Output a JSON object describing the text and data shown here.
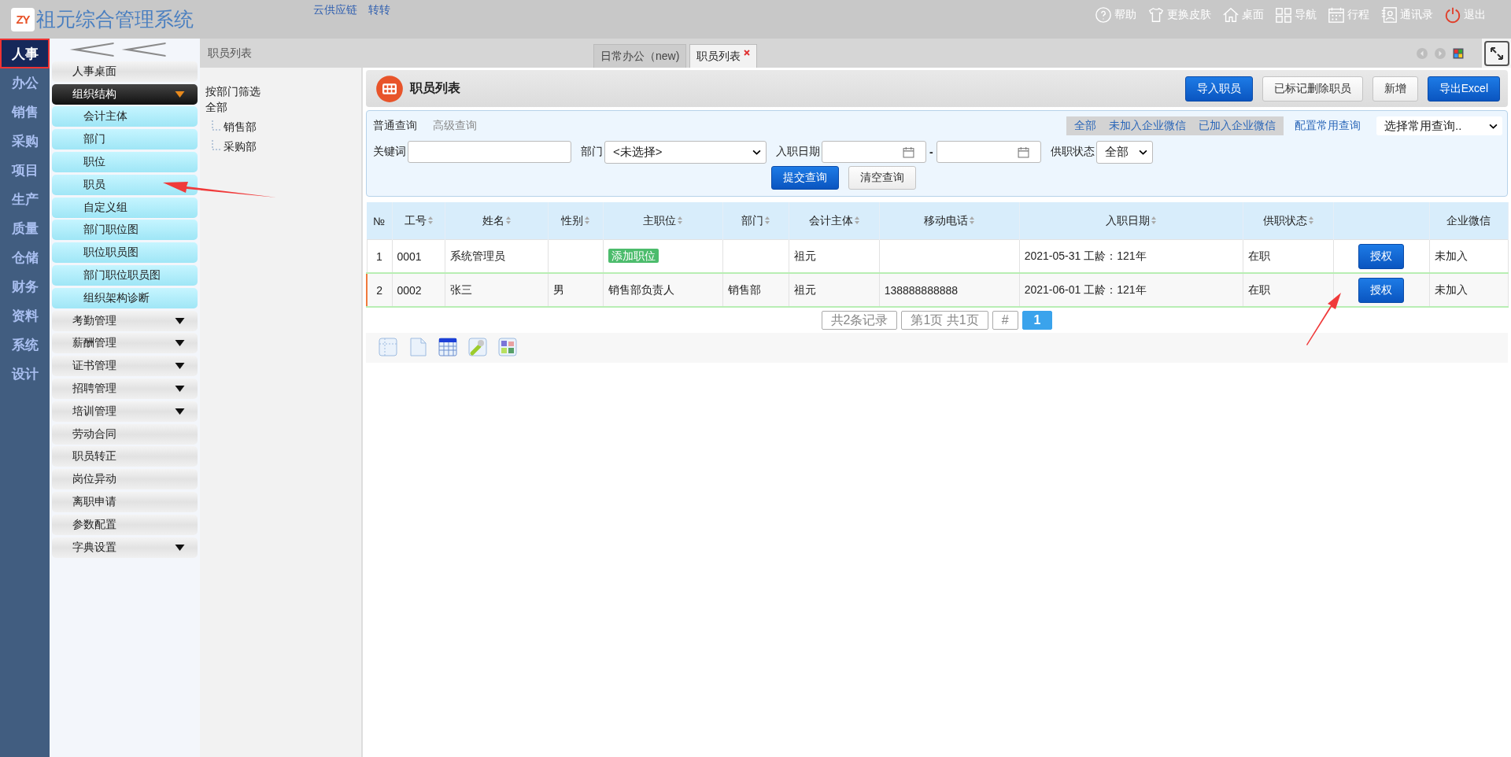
{
  "header": {
    "logo_mark": "ZY",
    "title": "祖元综合管理系统",
    "top_links": [
      "云供应链",
      "转转"
    ],
    "toolbar": [
      {
        "label": "帮助"
      },
      {
        "label": "更换皮肤"
      },
      {
        "label": "桌面"
      },
      {
        "label": "导航"
      },
      {
        "label": "行程"
      },
      {
        "label": "通讯录"
      },
      {
        "label": "退出"
      }
    ]
  },
  "module_nav": [
    {
      "label": "人事",
      "selected": true
    },
    {
      "label": "办公",
      "selected": false
    },
    {
      "label": "销售",
      "selected": false
    },
    {
      "label": "采购",
      "selected": false
    },
    {
      "label": "项目",
      "selected": false
    },
    {
      "label": "生产",
      "selected": false
    },
    {
      "label": "质量",
      "selected": false
    },
    {
      "label": "仓储",
      "selected": false
    },
    {
      "label": "财务",
      "selected": false
    },
    {
      "label": "资料",
      "selected": false
    },
    {
      "label": "系统",
      "selected": false
    },
    {
      "label": "设计",
      "selected": false
    }
  ],
  "sidebar": [
    {
      "label": "人事桌面",
      "kind": "item"
    },
    {
      "label": "组织结构",
      "kind": "group",
      "expanded": true,
      "children": [
        {
          "label": "会计主体"
        },
        {
          "label": "部门"
        },
        {
          "label": "职位"
        },
        {
          "label": "职员"
        },
        {
          "label": "自定义组"
        },
        {
          "label": "部门职位图"
        },
        {
          "label": "职位职员图"
        },
        {
          "label": "部门职位职员图"
        },
        {
          "label": "组织架构诊断"
        }
      ]
    },
    {
      "label": "考勤管理",
      "kind": "group",
      "expanded": false
    },
    {
      "label": "薪酬管理",
      "kind": "group",
      "expanded": false
    },
    {
      "label": "证书管理",
      "kind": "group",
      "expanded": false
    },
    {
      "label": "招聘管理",
      "kind": "group",
      "expanded": false
    },
    {
      "label": "培训管理",
      "kind": "group",
      "expanded": false
    },
    {
      "label": "劳动合同",
      "kind": "item"
    },
    {
      "label": "职员转正",
      "kind": "item"
    },
    {
      "label": "岗位异动",
      "kind": "item"
    },
    {
      "label": "离职申请",
      "kind": "item"
    },
    {
      "label": "参数配置",
      "kind": "item"
    },
    {
      "label": "字典设置",
      "kind": "group",
      "expanded": false
    }
  ],
  "breadcrumb": "职员列表",
  "tabs": [
    {
      "label": "日常办公（new)",
      "selected": false,
      "closable": false
    },
    {
      "label": "职员列表",
      "selected": true,
      "closable": true
    }
  ],
  "tree": {
    "title": "按部门筛选",
    "root": "全部",
    "children": [
      {
        "label": "销售部"
      },
      {
        "label": "采购部"
      }
    ]
  },
  "page": {
    "title": "职员列表",
    "buttons": [
      {
        "label": "导入职员",
        "kind": "primary"
      },
      {
        "label": "已标记删除职员",
        "kind": "default"
      },
      {
        "label": "新增",
        "kind": "default"
      },
      {
        "label": "导出Excel",
        "kind": "primary"
      }
    ]
  },
  "query": {
    "tabs": [
      {
        "label": "普通查询",
        "selected": true
      },
      {
        "label": "高级查询",
        "selected": false
      }
    ],
    "filters": [
      "全部",
      "未加入企业微信",
      "已加入企业微信"
    ],
    "config_link": "配置常用查询",
    "saved_query": "选择常用查询..",
    "keyword_label": "关键词",
    "dept_label": "部门",
    "dept_value": "<未选择>",
    "date_label": "入职日期",
    "date_separator": "-",
    "status_label": "供职状态",
    "status_value": "全部",
    "buttons": [
      {
        "label": "提交查询",
        "kind": "primary"
      },
      {
        "label": "清空查询",
        "kind": "default"
      }
    ]
  },
  "table": {
    "columns": [
      {
        "label": "№",
        "sortable": false
      },
      {
        "label": "工号",
        "sortable": true
      },
      {
        "label": "姓名",
        "sortable": true
      },
      {
        "label": "性别",
        "sortable": true
      },
      {
        "label": "主职位",
        "sortable": true
      },
      {
        "label": "部门",
        "sortable": true
      },
      {
        "label": "会计主体",
        "sortable": true
      },
      {
        "label": "移动电话",
        "sortable": true
      },
      {
        "label": "入职日期",
        "sortable": true
      },
      {
        "label": "供职状态",
        "sortable": true
      },
      {
        "sortable": false
      },
      {
        "label": "企业微信",
        "sortable": false
      }
    ],
    "rows": [
      {
        "selected": false,
        "no": "1",
        "id": "0001",
        "name": "系统管理员",
        "gender": "",
        "position": {
          "text": "添加职位",
          "kind": "badge"
        },
        "dept": "",
        "entity": "祖元",
        "phone": "",
        "hire_date": "2021-05-31 工龄：121年",
        "status": "在职",
        "action": "授权",
        "wechat": "未加入"
      },
      {
        "selected": true,
        "no": "2",
        "id": "0002",
        "name": "张三",
        "gender": "男",
        "position": {
          "text": "销售部负责人",
          "kind": "text"
        },
        "dept": "销售部",
        "entity": "祖元",
        "phone": "138888888888",
        "hire_date": "2021-06-01 工龄：121年",
        "status": "在职",
        "action": "授权",
        "wechat": "未加入"
      }
    ]
  },
  "pagination": {
    "summary": "共2条记录",
    "page_info": "第1页 共1页",
    "jump": "#",
    "pages": [
      {
        "label": "1",
        "selected": true
      }
    ]
  }
}
